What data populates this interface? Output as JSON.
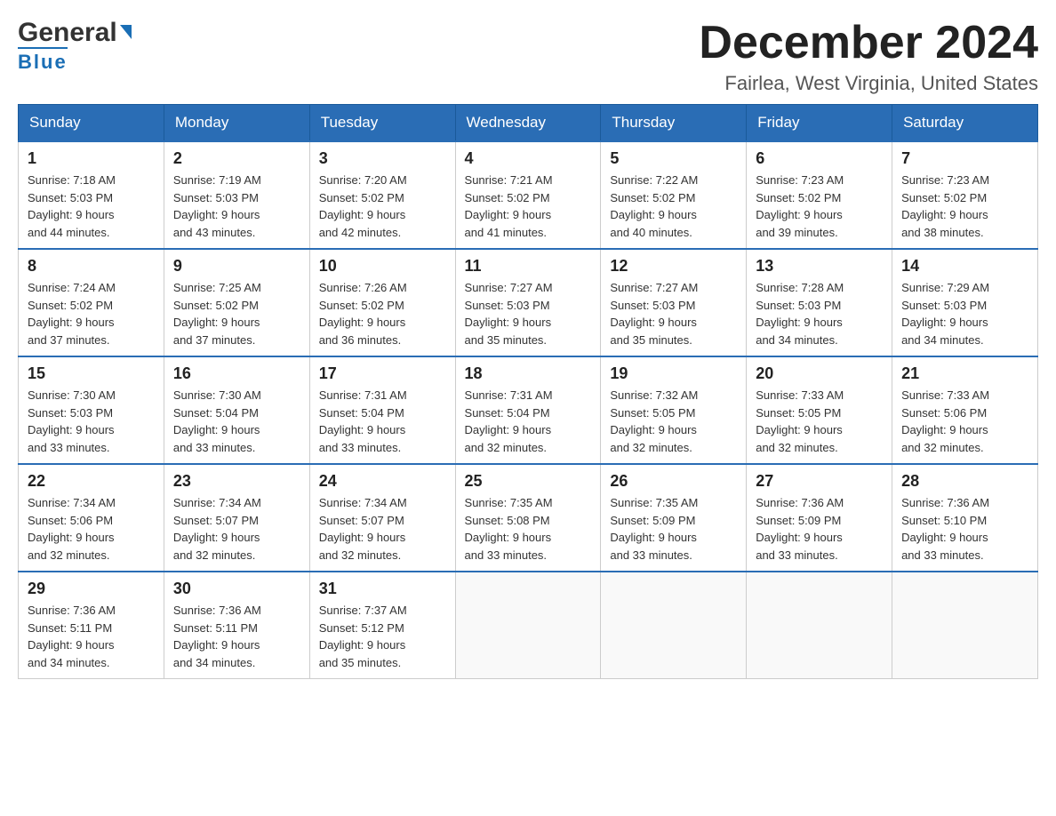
{
  "header": {
    "logo_general": "General",
    "logo_blue": "Blue",
    "main_title": "December 2024",
    "subtitle": "Fairlea, West Virginia, United States"
  },
  "days_of_week": [
    "Sunday",
    "Monday",
    "Tuesday",
    "Wednesday",
    "Thursday",
    "Friday",
    "Saturday"
  ],
  "weeks": [
    [
      {
        "day": "1",
        "sunrise": "7:18 AM",
        "sunset": "5:03 PM",
        "daylight": "9 hours and 44 minutes."
      },
      {
        "day": "2",
        "sunrise": "7:19 AM",
        "sunset": "5:03 PM",
        "daylight": "9 hours and 43 minutes."
      },
      {
        "day": "3",
        "sunrise": "7:20 AM",
        "sunset": "5:02 PM",
        "daylight": "9 hours and 42 minutes."
      },
      {
        "day": "4",
        "sunrise": "7:21 AM",
        "sunset": "5:02 PM",
        "daylight": "9 hours and 41 minutes."
      },
      {
        "day": "5",
        "sunrise": "7:22 AM",
        "sunset": "5:02 PM",
        "daylight": "9 hours and 40 minutes."
      },
      {
        "day": "6",
        "sunrise": "7:23 AM",
        "sunset": "5:02 PM",
        "daylight": "9 hours and 39 minutes."
      },
      {
        "day": "7",
        "sunrise": "7:23 AM",
        "sunset": "5:02 PM",
        "daylight": "9 hours and 38 minutes."
      }
    ],
    [
      {
        "day": "8",
        "sunrise": "7:24 AM",
        "sunset": "5:02 PM",
        "daylight": "9 hours and 37 minutes."
      },
      {
        "day": "9",
        "sunrise": "7:25 AM",
        "sunset": "5:02 PM",
        "daylight": "9 hours and 37 minutes."
      },
      {
        "day": "10",
        "sunrise": "7:26 AM",
        "sunset": "5:02 PM",
        "daylight": "9 hours and 36 minutes."
      },
      {
        "day": "11",
        "sunrise": "7:27 AM",
        "sunset": "5:03 PM",
        "daylight": "9 hours and 35 minutes."
      },
      {
        "day": "12",
        "sunrise": "7:27 AM",
        "sunset": "5:03 PM",
        "daylight": "9 hours and 35 minutes."
      },
      {
        "day": "13",
        "sunrise": "7:28 AM",
        "sunset": "5:03 PM",
        "daylight": "9 hours and 34 minutes."
      },
      {
        "day": "14",
        "sunrise": "7:29 AM",
        "sunset": "5:03 PM",
        "daylight": "9 hours and 34 minutes."
      }
    ],
    [
      {
        "day": "15",
        "sunrise": "7:30 AM",
        "sunset": "5:03 PM",
        "daylight": "9 hours and 33 minutes."
      },
      {
        "day": "16",
        "sunrise": "7:30 AM",
        "sunset": "5:04 PM",
        "daylight": "9 hours and 33 minutes."
      },
      {
        "day": "17",
        "sunrise": "7:31 AM",
        "sunset": "5:04 PM",
        "daylight": "9 hours and 33 minutes."
      },
      {
        "day": "18",
        "sunrise": "7:31 AM",
        "sunset": "5:04 PM",
        "daylight": "9 hours and 32 minutes."
      },
      {
        "day": "19",
        "sunrise": "7:32 AM",
        "sunset": "5:05 PM",
        "daylight": "9 hours and 32 minutes."
      },
      {
        "day": "20",
        "sunrise": "7:33 AM",
        "sunset": "5:05 PM",
        "daylight": "9 hours and 32 minutes."
      },
      {
        "day": "21",
        "sunrise": "7:33 AM",
        "sunset": "5:06 PM",
        "daylight": "9 hours and 32 minutes."
      }
    ],
    [
      {
        "day": "22",
        "sunrise": "7:34 AM",
        "sunset": "5:06 PM",
        "daylight": "9 hours and 32 minutes."
      },
      {
        "day": "23",
        "sunrise": "7:34 AM",
        "sunset": "5:07 PM",
        "daylight": "9 hours and 32 minutes."
      },
      {
        "day": "24",
        "sunrise": "7:34 AM",
        "sunset": "5:07 PM",
        "daylight": "9 hours and 32 minutes."
      },
      {
        "day": "25",
        "sunrise": "7:35 AM",
        "sunset": "5:08 PM",
        "daylight": "9 hours and 33 minutes."
      },
      {
        "day": "26",
        "sunrise": "7:35 AM",
        "sunset": "5:09 PM",
        "daylight": "9 hours and 33 minutes."
      },
      {
        "day": "27",
        "sunrise": "7:36 AM",
        "sunset": "5:09 PM",
        "daylight": "9 hours and 33 minutes."
      },
      {
        "day": "28",
        "sunrise": "7:36 AM",
        "sunset": "5:10 PM",
        "daylight": "9 hours and 33 minutes."
      }
    ],
    [
      {
        "day": "29",
        "sunrise": "7:36 AM",
        "sunset": "5:11 PM",
        "daylight": "9 hours and 34 minutes."
      },
      {
        "day": "30",
        "sunrise": "7:36 AM",
        "sunset": "5:11 PM",
        "daylight": "9 hours and 34 minutes."
      },
      {
        "day": "31",
        "sunrise": "7:37 AM",
        "sunset": "5:12 PM",
        "daylight": "9 hours and 35 minutes."
      },
      null,
      null,
      null,
      null
    ]
  ]
}
